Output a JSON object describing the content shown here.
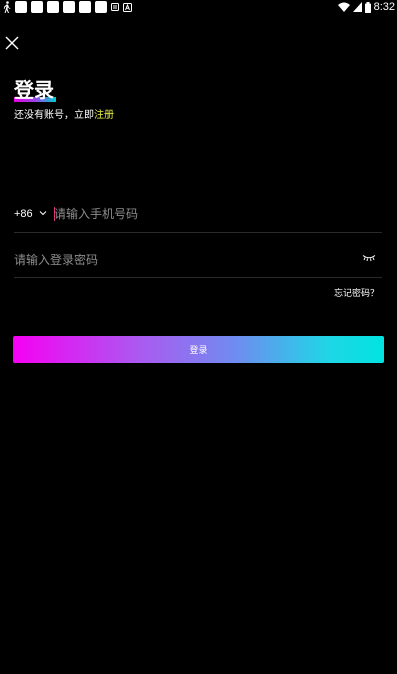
{
  "status_bar": {
    "time": "8:32",
    "left_icons": [
      "person-walk-icon",
      "app-icon",
      "app-icon",
      "app-icon",
      "app-icon",
      "app-icon",
      "app-icon",
      "message-icon",
      "text-icon"
    ],
    "right_icons": [
      "wifi-icon",
      "signal-icon",
      "battery-icon"
    ]
  },
  "header": {
    "close_icon": "close-icon"
  },
  "main": {
    "title": "登录",
    "subtitle_prefix": "还没有账号，立即",
    "register_link": "注册",
    "phone": {
      "country_code": "+86",
      "placeholder": "请输入手机号码",
      "value": ""
    },
    "password": {
      "placeholder": "请输入登录密码",
      "value": "",
      "toggle_icon": "eye-closed-icon"
    },
    "forgot_password": "忘记密码？",
    "login_button": "登录"
  },
  "colors": {
    "background": "#000000",
    "accent_link": "#e9f04a",
    "gradient_start": "#f600f3",
    "gradient_end": "#00e3e0",
    "cursor": "#e0337a"
  }
}
